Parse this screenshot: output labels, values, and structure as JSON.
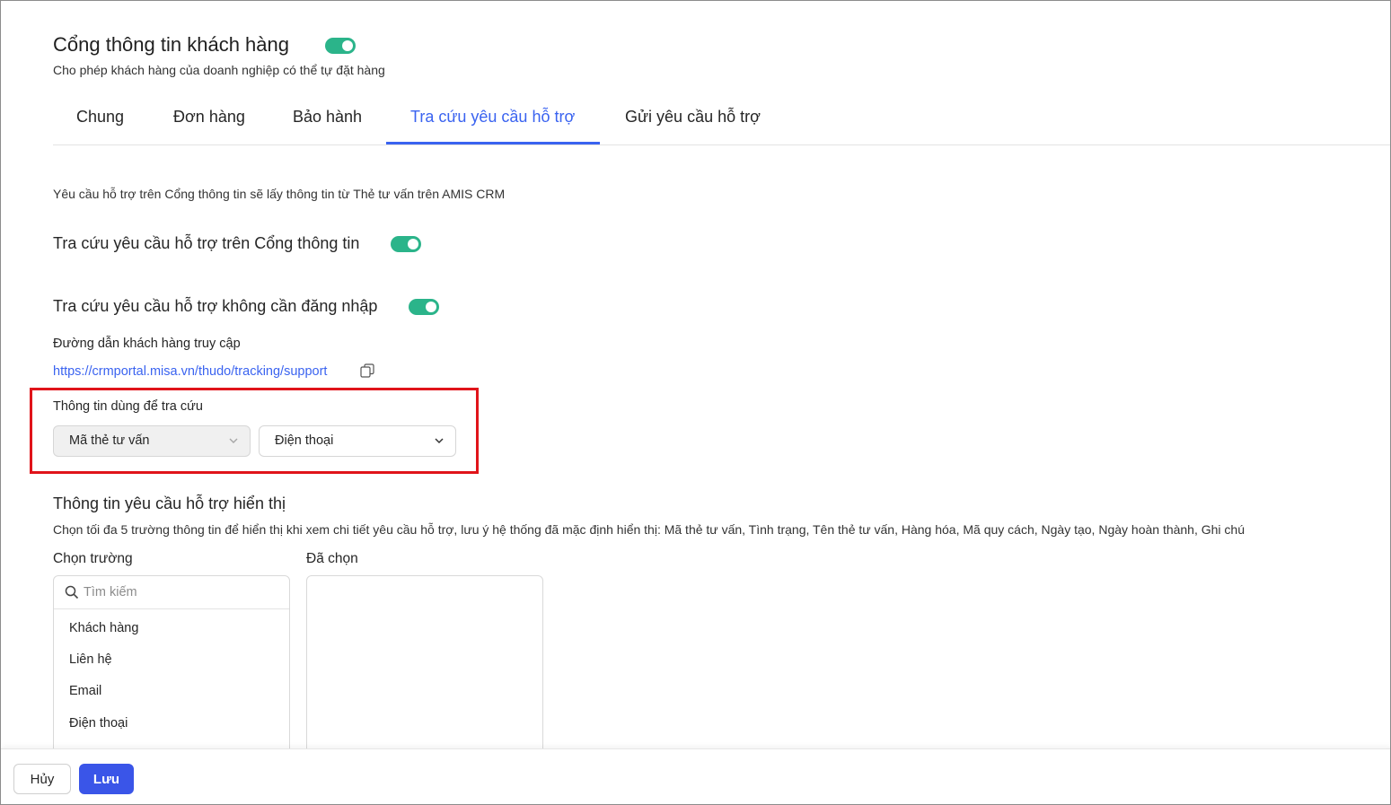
{
  "header": {
    "title": "Cổng thông tin khách hàng",
    "subtitle": "Cho phép khách hàng của doanh nghiệp có thể tự đặt hàng",
    "enabled": true
  },
  "tabs": [
    {
      "label": "Chung",
      "active": false
    },
    {
      "label": "Đơn hàng",
      "active": false
    },
    {
      "label": "Bảo hành",
      "active": false
    },
    {
      "label": "Tra cứu yêu cầu hỗ trợ",
      "active": true
    },
    {
      "label": "Gửi yêu cầu hỗ trợ",
      "active": false
    }
  ],
  "content": {
    "info_text": "Yêu cầu hỗ trợ trên Cổng thông tin sẽ lấy thông tin từ Thẻ tư vấn trên AMIS CRM",
    "lookup_portal": {
      "label": "Tra cứu yêu cầu hỗ trợ trên Cổng thông tin",
      "enabled": true
    },
    "lookup_no_login": {
      "label": "Tra cứu yêu cầu hỗ trợ không cần đăng nhập",
      "enabled": true
    },
    "access_link_label": "Đường dẫn khách hàng truy cập",
    "access_link_url": "https://crmportal.misa.vn/thudo/tracking/support",
    "lookup_info": {
      "label": "Thông tin dùng để tra cứu",
      "field1_value": "Mã thẻ tư vấn",
      "field2_value": "Điện thoại"
    },
    "display_section": {
      "title": "Thông tin yêu cầu hỗ trợ hiển thị",
      "description": "Chọn tối đa 5 trường thông tin để hiển thị khi xem chi tiết yêu cầu hỗ trợ, lưu ý hệ thống đã mặc định hiển thị: Mã thẻ tư vấn, Tình trạng, Tên thẻ tư vấn, Hàng hóa, Mã quy cách, Ngày tạo, Ngày hoàn thành, Ghi chú",
      "choose_label": "Chọn trường",
      "selected_label": "Đã chọn",
      "search_placeholder": "Tìm kiếm",
      "fields": [
        "Khách hàng",
        "Liên hệ",
        "Email",
        "Điện thoại"
      ]
    }
  },
  "footer": {
    "cancel_label": "Hủy",
    "save_label": "Lưu"
  },
  "colors": {
    "accent": "#3a63f0",
    "toggle_on": "#2bb48a",
    "highlight_border": "#e0141a",
    "save_button": "#3a55e8"
  }
}
